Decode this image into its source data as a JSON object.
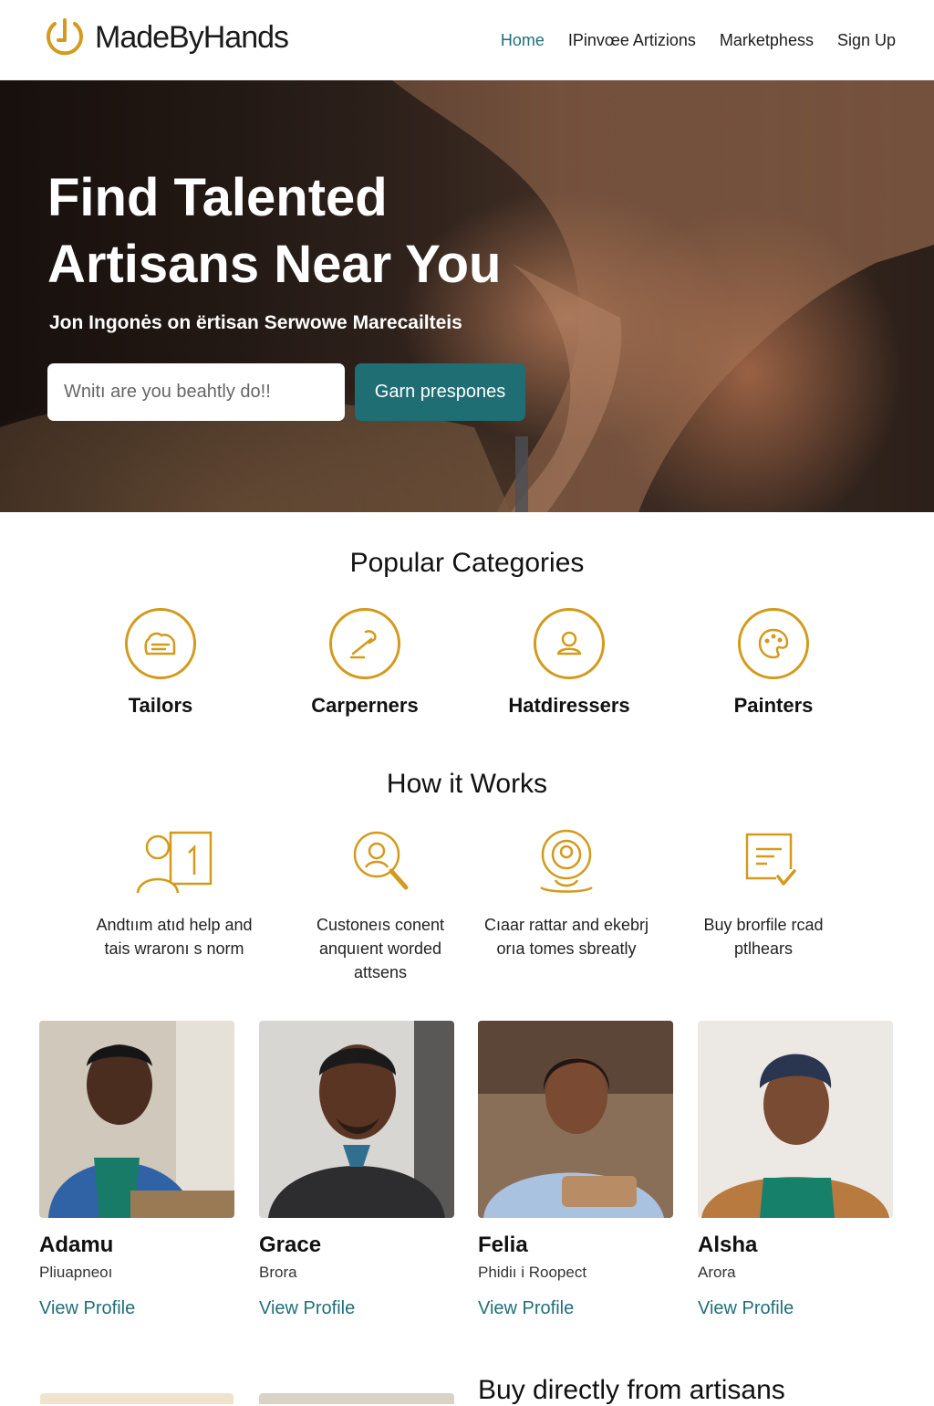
{
  "header": {
    "logo_text": "MadeByHands",
    "nav": [
      {
        "label": "Home",
        "active": true
      },
      {
        "label": "IPinvœe Artizions",
        "active": false
      },
      {
        "label": "Marketphess",
        "active": false
      },
      {
        "label": "Sign Up",
        "active": false
      }
    ]
  },
  "hero": {
    "title": "Find Talented Artisans Near You",
    "subtitle": "Jon Ingonės on ërtisan Serwowe Marecailteis",
    "search_placeholder": "Wnitı are you beahtly do!!",
    "search_button": "Garn prespones"
  },
  "categories": {
    "title": "Popular Categories",
    "items": [
      {
        "label": "Tailors",
        "icon": "sewing-icon"
      },
      {
        "label": "Carperners",
        "icon": "carpentry-icon"
      },
      {
        "label": "Hatdiressers",
        "icon": "person-icon"
      },
      {
        "label": "Painters",
        "icon": "palette-icon"
      }
    ]
  },
  "how": {
    "title": "How it Works",
    "steps": [
      {
        "text": "Andtıım atıd help and tais wraronı s norm",
        "icon": "profile-number-icon"
      },
      {
        "text": "Custoneıs conent anquıent worded attsens",
        "icon": "search-icon"
      },
      {
        "text": "Cıaar rattar and ekebrj orıa tomes sbreatly",
        "icon": "location-pin-icon"
      },
      {
        "text": "Buy brorfile rcad ptlhears",
        "icon": "document-check-icon"
      }
    ]
  },
  "artisans": [
    {
      "name": "Adamu",
      "role": "Pliuapneoı",
      "link": "View Profile"
    },
    {
      "name": "Grace",
      "role": "Brora",
      "link": "View Profile"
    },
    {
      "name": "Felia",
      "role": "Phidiı i Roopect",
      "link": "View Profile"
    },
    {
      "name": "Alsha",
      "role": "Arora",
      "link": "View Profile"
    }
  ],
  "teaser": {
    "title": "Buy directly from artisans"
  },
  "colors": {
    "accent_teal": "#1f6f78",
    "icon_gold": "#d39a1c",
    "button_teal": "#1e6e73"
  }
}
